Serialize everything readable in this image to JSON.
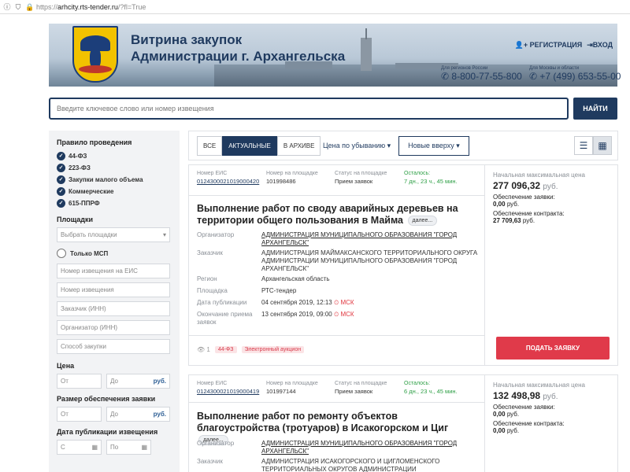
{
  "browser": {
    "url_host": "arhcity.rts-tender.ru",
    "url_rest": "/?fl=True",
    "url_scheme": "https://"
  },
  "header": {
    "title_line1": "Витрина закупок",
    "title_line2": "Администрации г. Архангельска",
    "register": "РЕГИСТРАЦИЯ",
    "login": "ВХОД",
    "phone1_caption": "Для регионов России",
    "phone1": "8-800-77-55-800",
    "phone2_caption": "Для Москвы и области",
    "phone2": "+7 (499) 653-55-00"
  },
  "search": {
    "placeholder": "Введите ключевое слово или номер извещения",
    "button": "НАЙТИ"
  },
  "sidebar": {
    "rules_title": "Правило проведения",
    "rules": [
      "44-ФЗ",
      "223-ФЗ",
      "Закупки малого объема",
      "Коммерческие",
      "615-ППРФ"
    ],
    "platforms_title": "Площадки",
    "platforms_placeholder": "Выбрать площадки",
    "msp_label": "Только МСП",
    "field_eis": "Номер извещения на ЕИС",
    "field_notice": "Номер извещения",
    "field_customer": "Заказчик (ИНН)",
    "field_organizer": "Организатор (ИНН)",
    "field_method": "Способ закупки",
    "price_title": "Цена",
    "from": "От",
    "to": "До",
    "rub": "руб.",
    "deposit_title": "Размер обеспечения заявки",
    "date_title": "Дата публикации извещения",
    "date_from": "С",
    "date_to": "По"
  },
  "toolbar": {
    "filter_all": "ВСЕ",
    "filter_active": "АКТУАЛЬНЫЕ",
    "filter_archive": "В АРХИВЕ",
    "sort_price": "Цена по убыванию ▾",
    "sort_new": "Новые вверху ▾"
  },
  "labels": {
    "eis_no": "Номер ЕИС",
    "platform_no": "Номер на площадке",
    "status_on_platform": "Статус на площадке",
    "remaining": "Осталось:",
    "organizer": "Организатор",
    "customer": "Заказчик",
    "region": "Регион",
    "platform": "Площадка",
    "pub_date": "Дата публикации",
    "end_date": "Окончание приема заявок",
    "start_price": "Начальная максимальная цена",
    "bid_security": "Обеспечение заявки:",
    "contract_security": "Обеспечение контракта:",
    "more": "далее...",
    "submit": "ПОДАТЬ ЗАЯВКУ",
    "currency": "руб.",
    "tz": "МСК"
  },
  "tenders": [
    {
      "eis_no": "0124300021019000420",
      "platform_no": "101998486",
      "status": "Прием заявок",
      "remaining": "7 дн., 23 ч., 45 мин.",
      "title": "Выполнение работ по своду аварийных деревьев на территории общего пользования в Майма",
      "organizer": "АДМИНИСТРАЦИЯ МУНИЦИПАЛЬНОГО ОБРАЗОВАНИЯ \"ГОРОД АРХАНГЕЛЬСК\"",
      "customer": "АДМИНИСТРАЦИЯ МАЙМАКСАНСКОГО ТЕРРИТОРИАЛЬНОГО ОКРУГА АДМИНИСТРАЦИИ МУНИЦИПАЛЬНОГО ОБРАЗОВАНИЯ \"ГОРОД АРХАНГЕЛЬСК\"",
      "region": "Архангельская область",
      "platform": "РТС-тендер",
      "pub_date": "04 сентября 2019, 12:13",
      "end_date": "13 сентября 2019, 09:00",
      "views": "1",
      "law_tag": "44-ФЗ",
      "method_tag": "Электронный аукцион",
      "price": "277 096,32",
      "bid_security": "0,00",
      "bid_security_unit": "руб.",
      "contract_security": "27 709,63",
      "contract_security_unit": "руб."
    },
    {
      "eis_no": "0124300021019000419",
      "platform_no": "101997144",
      "status": "Прием заявок",
      "remaining": "6 дн., 23 ч., 45 мин.",
      "title": "Выполнение работ по ремонту объектов благоустройства (тротуаров) в Исакогорском и Циг",
      "organizer": "АДМИНИСТРАЦИЯ МУНИЦИПАЛЬНОГО ОБРАЗОВАНИЯ \"ГОРОД АРХАНГЕЛЬСК\"",
      "customer": "АДМИНИСТРАЦИЯ ИСАКОГОРСКОГО И ЦИГЛОМЕНСКОГО ТЕРРИТОРИАЛЬНЫХ ОКРУГОВ АДМИНИСТРАЦИИ",
      "price": "132 498,98",
      "bid_security": "0,00",
      "bid_security_unit": "руб.",
      "contract_security": "0,00",
      "contract_security_unit": "руб."
    }
  ]
}
